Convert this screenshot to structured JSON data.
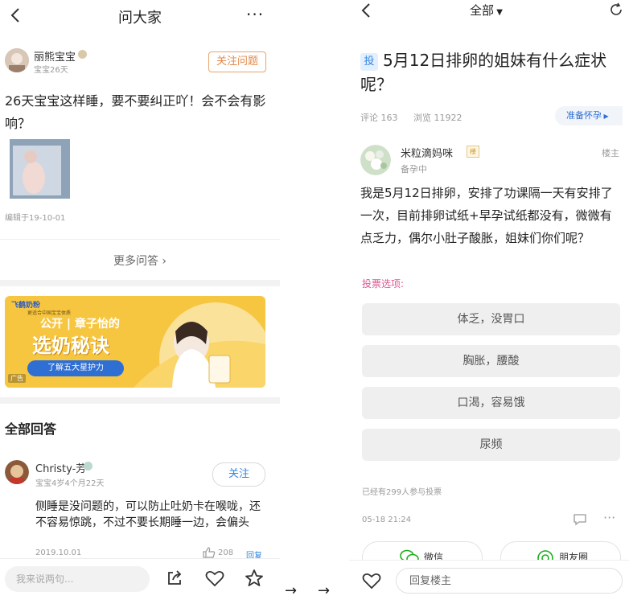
{
  "left": {
    "header": {
      "title": "问大家"
    },
    "question": {
      "author_name": "丽熊宝宝",
      "author_sub": "宝宝26天",
      "follow_label": "关注问题",
      "text": "26天宝宝这样睡，要不要纠正吖！会不会有影响？",
      "edited": "编辑于19-10-01"
    },
    "more_label": "更多问答",
    "ad": {
      "brand": "飞鹤奶粉",
      "brand_sub": "更适合中国宝宝体质",
      "line1": "公开 | 章子怡的",
      "line2": "选奶秘诀",
      "cta": "了解五大星护力",
      "tag": "广告"
    },
    "answers_title": "全部回答",
    "answer": {
      "name": "Christy-芳",
      "sub": "宝宝4岁4个月22天",
      "follow_label": "关注",
      "text": "侧睡是没问题的，可以防止吐奶卡在喉咙，还不容易惊跳，不过不要长期睡一边，会偏头",
      "date": "2019.10.01",
      "likes": "208",
      "reply_label": "回复"
    },
    "input_placeholder": "我来说两句..."
  },
  "right": {
    "header": {
      "title": "全部"
    },
    "post": {
      "badge": "投",
      "title": "5月12日排卵的姐妹有什么症状呢？",
      "comments": "评论 163",
      "views": "浏览 11922",
      "tag": "准备怀孕",
      "author_name": "米粒滴妈咪",
      "author_sub": "备孕中",
      "floor": "楼主",
      "text": "我是5月12日排卵，安排了功课隔一天有安排了一次，目前排卵试纸+早孕试纸都没有，微微有点乏力，偶尔小肚子酸胀，姐妹们你们呢？",
      "vote_label": "投票选项:",
      "options": [
        "体乏，没胃口",
        "胸胀，腰酸",
        "口渴，容易饿",
        "尿频"
      ],
      "participants": "已经有299人参与投票",
      "time": "05-18 21:24"
    },
    "share": {
      "wechat": "微信",
      "moments": "朋友圈"
    },
    "reply_placeholder": "回复楼主"
  },
  "arrows": [
    "→",
    "→"
  ],
  "colors": {
    "accent_orange": "#e0894a",
    "vote_pink": "#e0558f",
    "blue_badge": "#2f87e0"
  }
}
